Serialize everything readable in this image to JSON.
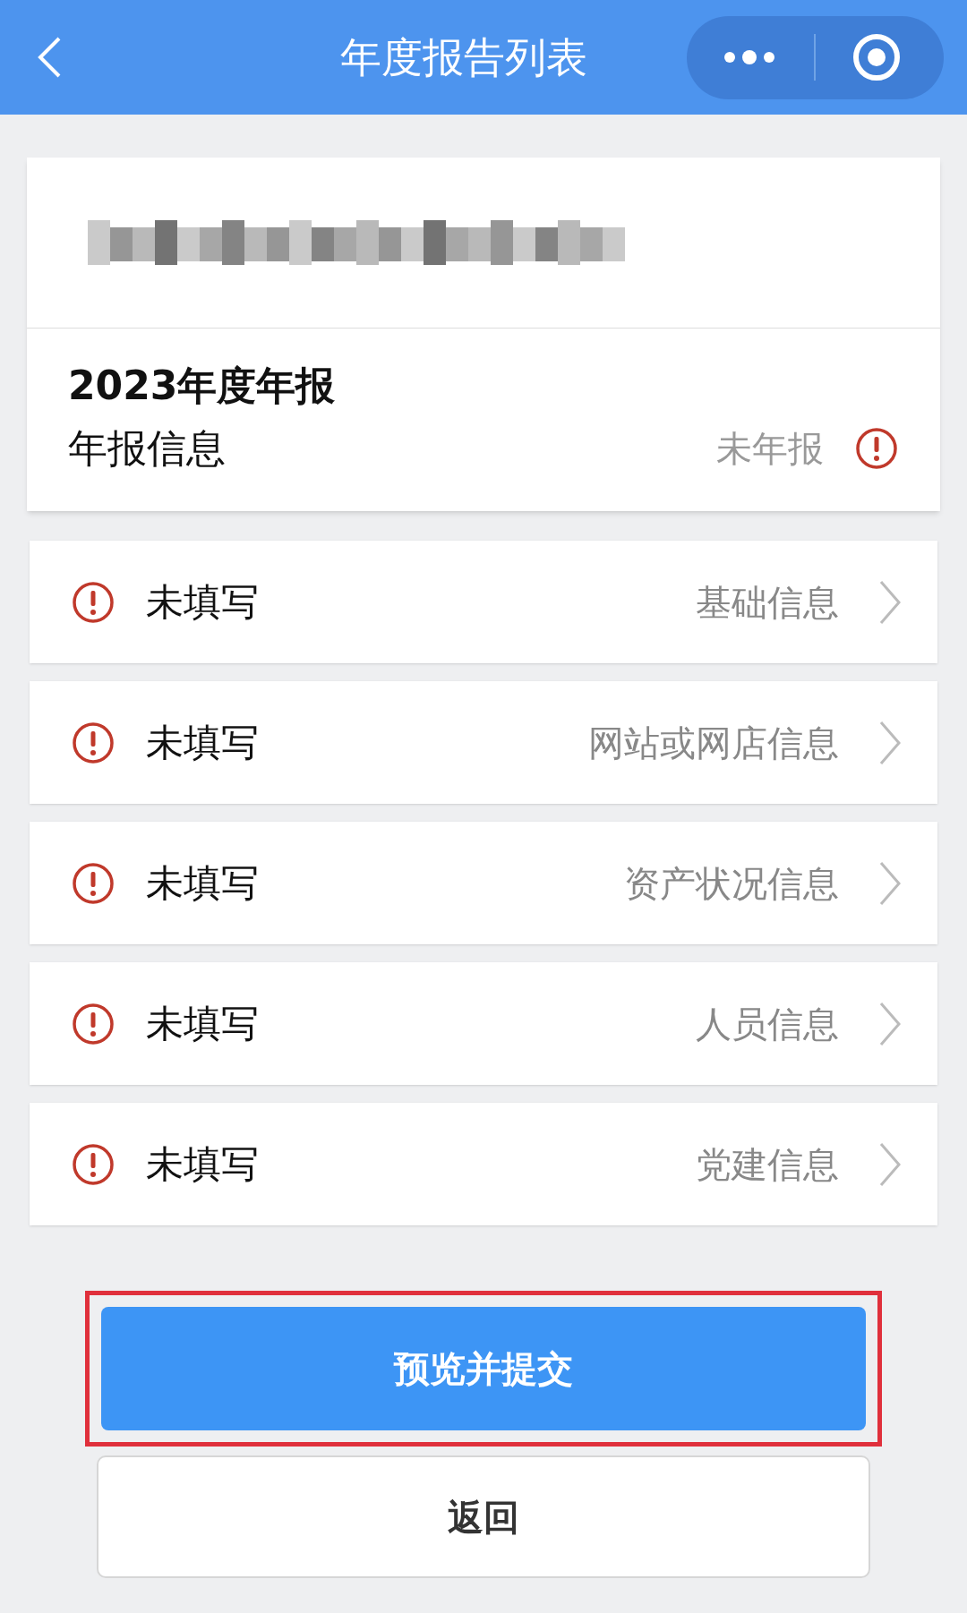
{
  "header": {
    "title": "年度报告列表"
  },
  "report": {
    "year_title": "2023年度年报",
    "label": "年报信息",
    "status": "未年报"
  },
  "sections": [
    {
      "status": "未填写",
      "name": "基础信息"
    },
    {
      "status": "未填写",
      "name": "网站或网店信息"
    },
    {
      "status": "未填写",
      "name": "资产状况信息"
    },
    {
      "status": "未填写",
      "name": "人员信息"
    },
    {
      "status": "未填写",
      "name": "党建信息"
    }
  ],
  "buttons": {
    "submit": {
      "label": "预览并提交",
      "highlighted": true
    },
    "back": {
      "label": "返回"
    }
  }
}
